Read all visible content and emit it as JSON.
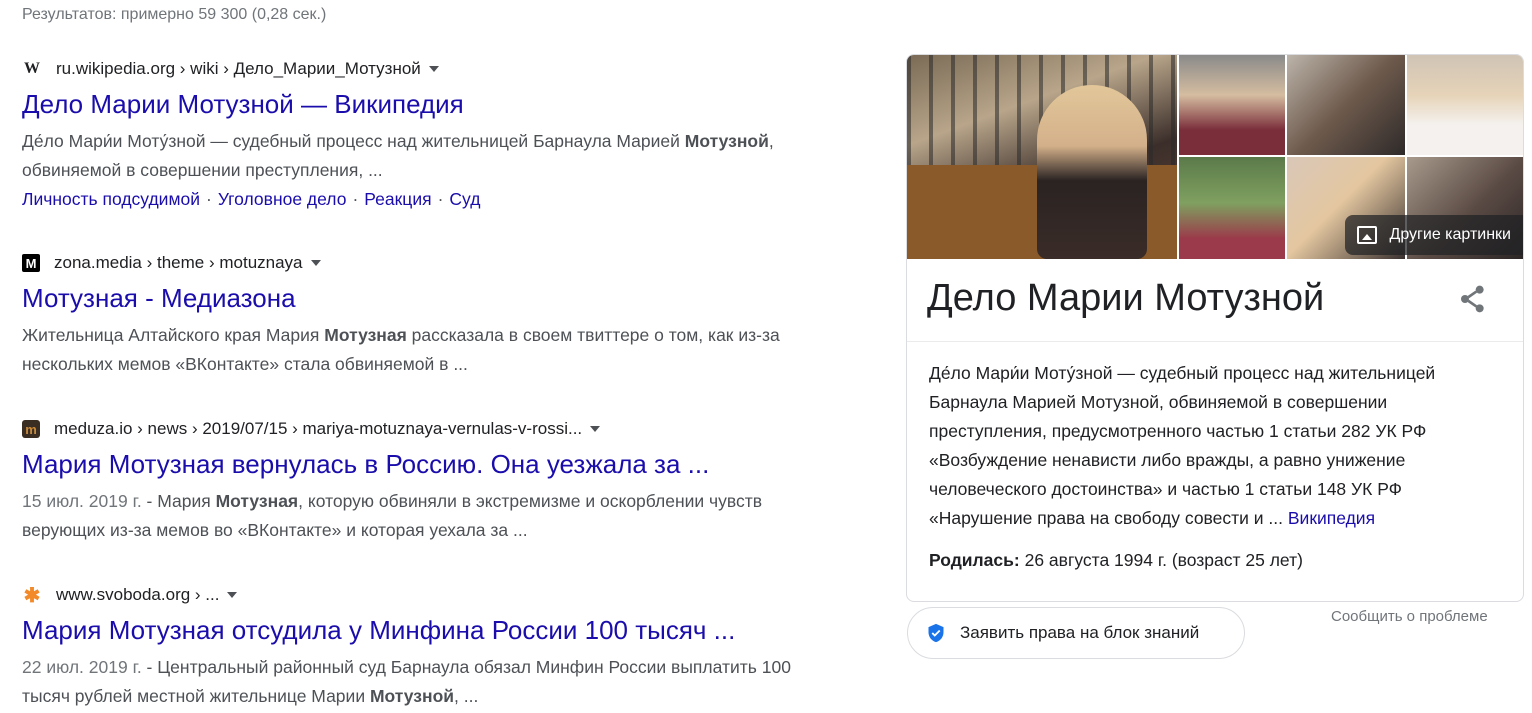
{
  "stats": "Результатов: примерно 59 300 (0,28 сек.)",
  "results": [
    {
      "favicon": "W",
      "cite": "ru.wikipedia.org › wiki › Дело_Марии_Мотузной",
      "title": "Дело Марии Мотузной — Википедия",
      "snippet_pre": "Де́ло Мари́и Моту́зной — судебный процесс над жительницей Барнаула Марией ",
      "snippet_bold": "Мотузной",
      "snippet_post": ", обвиняемой в совершении преступления, ...",
      "sitelinks": [
        "Личность подсудимой",
        "Уголовное дело",
        "Реакция",
        "Суд"
      ]
    },
    {
      "favicon": "M",
      "cite": "zona.media › theme › motuznaya",
      "title": "Мотузная - Медиазона",
      "snippet_pre": "Жительница Алтайского края Мария ",
      "snippet_bold": "Мотузная",
      "snippet_post": " рассказала в своем твиттере о том, как из-за нескольких мемов «ВКонтакте» стала обвиняемой в ..."
    },
    {
      "favicon": "m",
      "cite": "meduza.io › news › 2019/07/15 › mariya-motuznaya-vernulas-v-rossi...",
      "title": "Мария Мотузная вернулась в Россию. Она уезжала за ...",
      "date": "15 июл. 2019 г.",
      "snippet_pre": " - Мария ",
      "snippet_bold": "Мотузная",
      "snippet_post": ", которую обвиняли в экстремизме и оскорблении чувств верующих из-за мемов во «ВКонтакте» и которая уехала за ..."
    },
    {
      "favicon": "✱",
      "cite": "www.svoboda.org › ...",
      "title": "Мария Мотузная отсудила у Минфина России 100 тысяч ...",
      "date": "22 июл. 2019 г.",
      "snippet_pre": " - Центральный районный суд Барнаула обязал Минфин России выплатить 100 тысяч рублей местной жительнице Марии ",
      "snippet_bold": "Мотузной",
      "snippet_post": ", ..."
    }
  ],
  "knowledge_panel": {
    "more_images": "Другие картинки",
    "title": "Дело Марии Мотузной",
    "description": "Де́ло Мари́и Моту́зной — судебный процесс над жительницей Барнаула Марией Мотузной, обвиняемой в совершении преступления, предусмотренного частью 1 статьи 282 УК РФ «Возбуждение ненависти либо вражды, а равно унижение человеческого достоинства» и частью 1 статьи 148 УК РФ «Нарушение права на свободу совести и ... ",
    "source": "Википедия",
    "born_label": "Родилась:",
    "born_value": " 26 августа 1994 г. (возраст 25 лет)"
  },
  "claim_button": "Заявить права на блок знаний",
  "feedback": "Сообщить о проблеме",
  "colors": {
    "link": "#1a0dab",
    "text": "#4d5156",
    "claim_badge": "#1a73e8"
  }
}
